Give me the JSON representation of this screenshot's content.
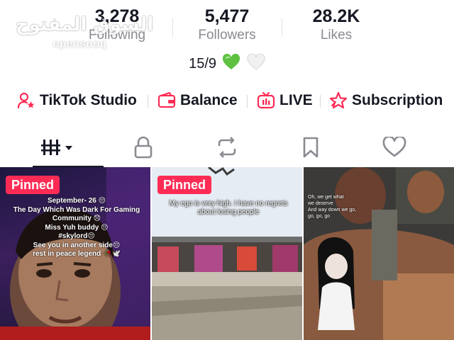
{
  "stats": {
    "following": {
      "value": "3,278",
      "label": "Following"
    },
    "followers": {
      "value": "5,477",
      "label": "Followers"
    },
    "likes": {
      "value": "28.2K",
      "label": "Likes"
    }
  },
  "watermark": {
    "arabic": "السوق المفتوح",
    "latin": "opensooq"
  },
  "badge": {
    "date": "15/9",
    "hearts": [
      "green-heart-icon",
      "white-heart-icon"
    ]
  },
  "shortcuts": [
    {
      "label": "TikTok Studio",
      "icon": "studio-person-star-icon"
    },
    {
      "label": "Balance",
      "icon": "wallet-icon"
    },
    {
      "label": "LIVE",
      "icon": "live-tv-icon"
    },
    {
      "label": "Subscription",
      "icon": "subscription-star-icon"
    }
  ],
  "tabs": [
    {
      "icon": "videos-grid-icon",
      "active": true
    },
    {
      "icon": "lock-icon",
      "active": false
    },
    {
      "icon": "repost-icon",
      "active": false
    },
    {
      "icon": "bookmark-icon",
      "active": false
    },
    {
      "icon": "heart-outline-icon",
      "active": false
    }
  ],
  "videos": [
    {
      "pinned_label": "Pinned",
      "caption": [
        "September- 26 😔",
        "The Day Which Was Dark For Gaming",
        "Community 😞",
        "Miss Yuh buddy 😔",
        "#skylord😔",
        "See you in another side😔",
        "rest in peace legend 🥀🕊️"
      ]
    },
    {
      "pinned_label": "Pinned",
      "caption": [
        "My ego is very high. I have no regrets",
        "about losing people"
      ]
    },
    {
      "pinned_label": "",
      "caption": [
        "Oh, we get what",
        "we deserve",
        "And way down we go,",
        "go, go, go"
      ]
    }
  ],
  "colors": {
    "accent": "#fe2c55",
    "text": "#161823",
    "muted": "#8a8b91",
    "heart_green": "#5ec142"
  }
}
